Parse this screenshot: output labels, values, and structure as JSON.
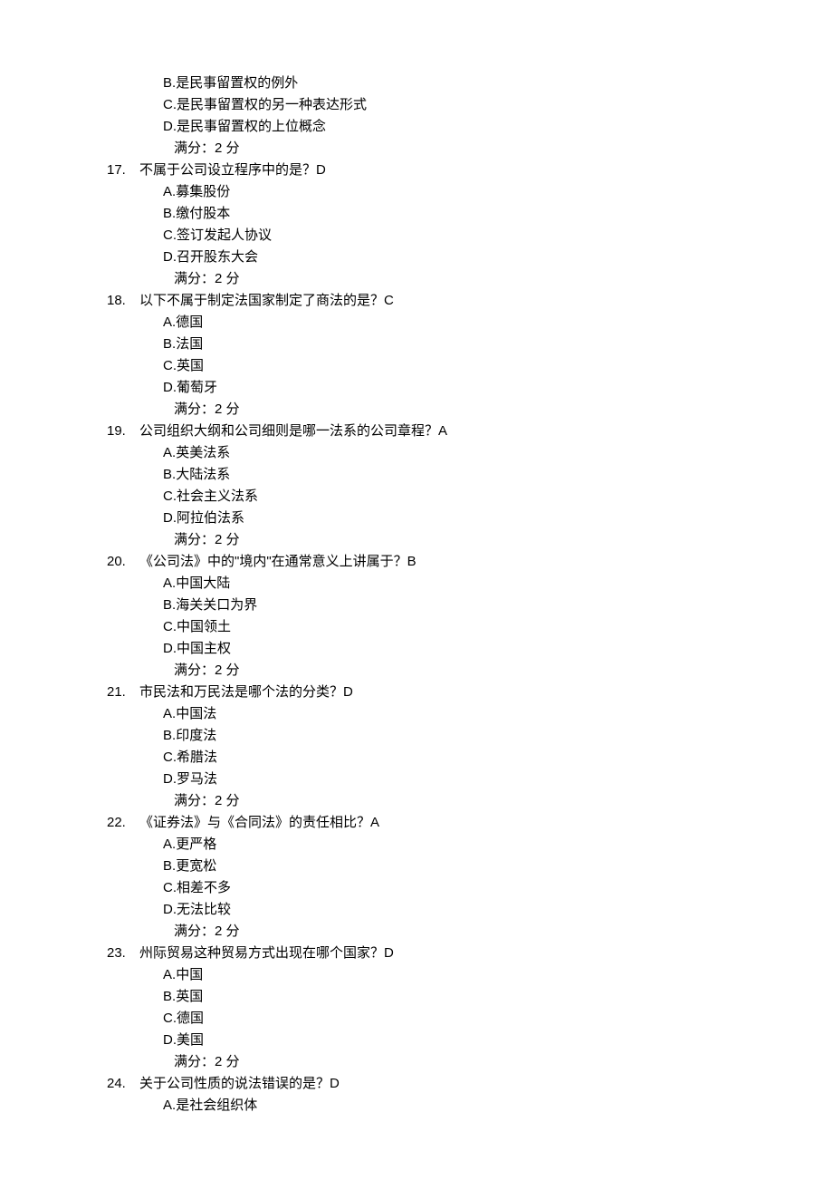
{
  "partial_q16": {
    "options": [
      {
        "letter": "B.",
        "text": "是民事留置权的例外"
      },
      {
        "letter": "C.",
        "text": "是民事留置权的另一种表达形式"
      },
      {
        "letter": "D.",
        "text": "是民事留置权的上位概念"
      }
    ],
    "score": "满分：2   分"
  },
  "questions": [
    {
      "num": "17.",
      "text": "不属于公司设立程序中的是？D",
      "options": [
        {
          "letter": "A.",
          "text": "募集股份"
        },
        {
          "letter": "B.",
          "text": "缴付股本"
        },
        {
          "letter": "C.",
          "text": "签订发起人协议"
        },
        {
          "letter": "D.",
          "text": "召开股东大会"
        }
      ],
      "score": "满分：2   分"
    },
    {
      "num": "18.",
      "text": "以下不属于制定法国家制定了商法的是？C",
      "options": [
        {
          "letter": "A.",
          "text": "德国"
        },
        {
          "letter": "B.",
          "text": "法国"
        },
        {
          "letter": "C.",
          "text": "英国"
        },
        {
          "letter": "D.",
          "text": "葡萄牙"
        }
      ],
      "score": "满分：2   分"
    },
    {
      "num": "19.",
      "text": "公司组织大纲和公司细则是哪一法系的公司章程？A",
      "options": [
        {
          "letter": "A.",
          "text": "英美法系"
        },
        {
          "letter": "B.",
          "text": "大陆法系"
        },
        {
          "letter": "C.",
          "text": "社会主义法系"
        },
        {
          "letter": "D.",
          "text": "阿拉伯法系"
        }
      ],
      "score": "满分：2   分"
    },
    {
      "num": "20.",
      "text": "《公司法》中的\"境内\"在通常意义上讲属于？B",
      "options": [
        {
          "letter": "A.",
          "text": "中国大陆"
        },
        {
          "letter": "B.",
          "text": "海关关口为界"
        },
        {
          "letter": "C.",
          "text": "中国领土"
        },
        {
          "letter": "D.",
          "text": "中国主权"
        }
      ],
      "score": "满分：2   分"
    },
    {
      "num": "21.",
      "text": "市民法和万民法是哪个法的分类？D",
      "options": [
        {
          "letter": "A.",
          "text": "中国法"
        },
        {
          "letter": "B.",
          "text": "印度法"
        },
        {
          "letter": "C.",
          "text": "希腊法"
        },
        {
          "letter": "D.",
          "text": "罗马法"
        }
      ],
      "score": "满分：2   分"
    },
    {
      "num": "22.",
      "text": "《证券法》与《合同法》的责任相比？A",
      "options": [
        {
          "letter": "A.",
          "text": "更严格"
        },
        {
          "letter": "B.",
          "text": "更宽松"
        },
        {
          "letter": "C.",
          "text": "相差不多"
        },
        {
          "letter": "D.",
          "text": "无法比较"
        }
      ],
      "score": "满分：2   分"
    },
    {
      "num": "23.",
      "text": "州际贸易这种贸易方式出现在哪个国家？D",
      "options": [
        {
          "letter": "A.",
          "text": "中国"
        },
        {
          "letter": "B.",
          "text": "英国"
        },
        {
          "letter": "C.",
          "text": "德国"
        },
        {
          "letter": "D.",
          "text": "美国"
        }
      ],
      "score": "满分：2   分"
    },
    {
      "num": "24.",
      "text": "关于公司性质的说法错误的是？D",
      "options": [
        {
          "letter": "A.",
          "text": "是社会组织体"
        }
      ],
      "score": null
    }
  ]
}
